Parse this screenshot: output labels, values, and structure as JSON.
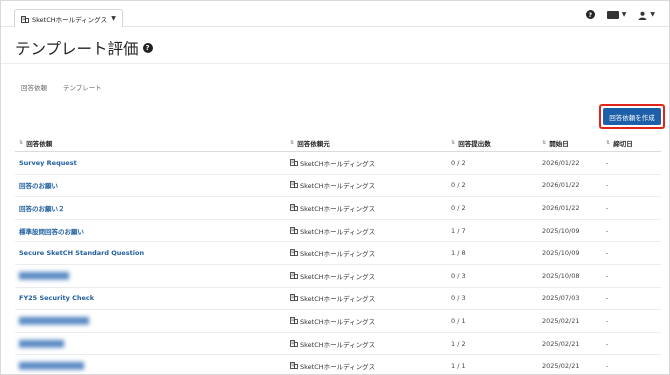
{
  "org_switcher": {
    "label": "SketCHホールディングス"
  },
  "page": {
    "title": "テンプレート評価"
  },
  "tabs": [
    {
      "label": "回答依頼"
    },
    {
      "label": "テンプレート"
    }
  ],
  "actions": {
    "create_label": "回答依頼を作成"
  },
  "table": {
    "headers": [
      "回答依頼",
      "回答依頼元",
      "回答提出数",
      "開始日",
      "締切日"
    ],
    "rows": [
      {
        "name": "Survey Request",
        "blurred": false,
        "requester": "SketCHホールディングス",
        "count": "0 / 2",
        "start": "2026/01/22",
        "deadline": "-"
      },
      {
        "name": "回答のお願い",
        "blurred": false,
        "requester": "SketCHホールディングス",
        "count": "0 / 2",
        "start": "2026/01/22",
        "deadline": "-"
      },
      {
        "name": "回答のお願い２",
        "blurred": false,
        "requester": "SketCHホールディングス",
        "count": "0 / 2",
        "start": "2026/01/22",
        "deadline": "-"
      },
      {
        "name": "標準設問回答のお願い",
        "blurred": false,
        "requester": "SketCHホールディングス",
        "count": "1 / 7",
        "start": "2025/10/09",
        "deadline": "-"
      },
      {
        "name": "Secure SketCH Standard Question",
        "blurred": false,
        "requester": "SketCHホールディングス",
        "count": "1 / 8",
        "start": "2025/10/09",
        "deadline": "-"
      },
      {
        "name": "██████████",
        "blurred": true,
        "requester": "SketCHホールディングス",
        "count": "0 / 3",
        "start": "2025/10/08",
        "deadline": "-"
      },
      {
        "name": "FY25 Security Check",
        "blurred": false,
        "requester": "SketCHホールディングス",
        "count": "0 / 3",
        "start": "2025/07/03",
        "deadline": "-"
      },
      {
        "name": "██████████████",
        "blurred": true,
        "requester": "SketCHホールディングス",
        "count": "0 / 1",
        "start": "2025/02/21",
        "deadline": "-"
      },
      {
        "name": "█████████",
        "blurred": true,
        "requester": "SketCHホールディングス",
        "count": "1 / 2",
        "start": "2025/02/21",
        "deadline": "-"
      },
      {
        "name": "█████████████",
        "blurred": true,
        "requester": "SketCHホールディングス",
        "count": "1 / 1",
        "start": "2025/02/21",
        "deadline": "-"
      }
    ]
  },
  "icons": {
    "help": "help-circle-icon",
    "language": "language-icon",
    "user": "user-icon",
    "building": "building-icon"
  },
  "colors": {
    "primary": "#1d5fa8",
    "link": "#1f5fa0",
    "highlight": "#e0241b"
  }
}
